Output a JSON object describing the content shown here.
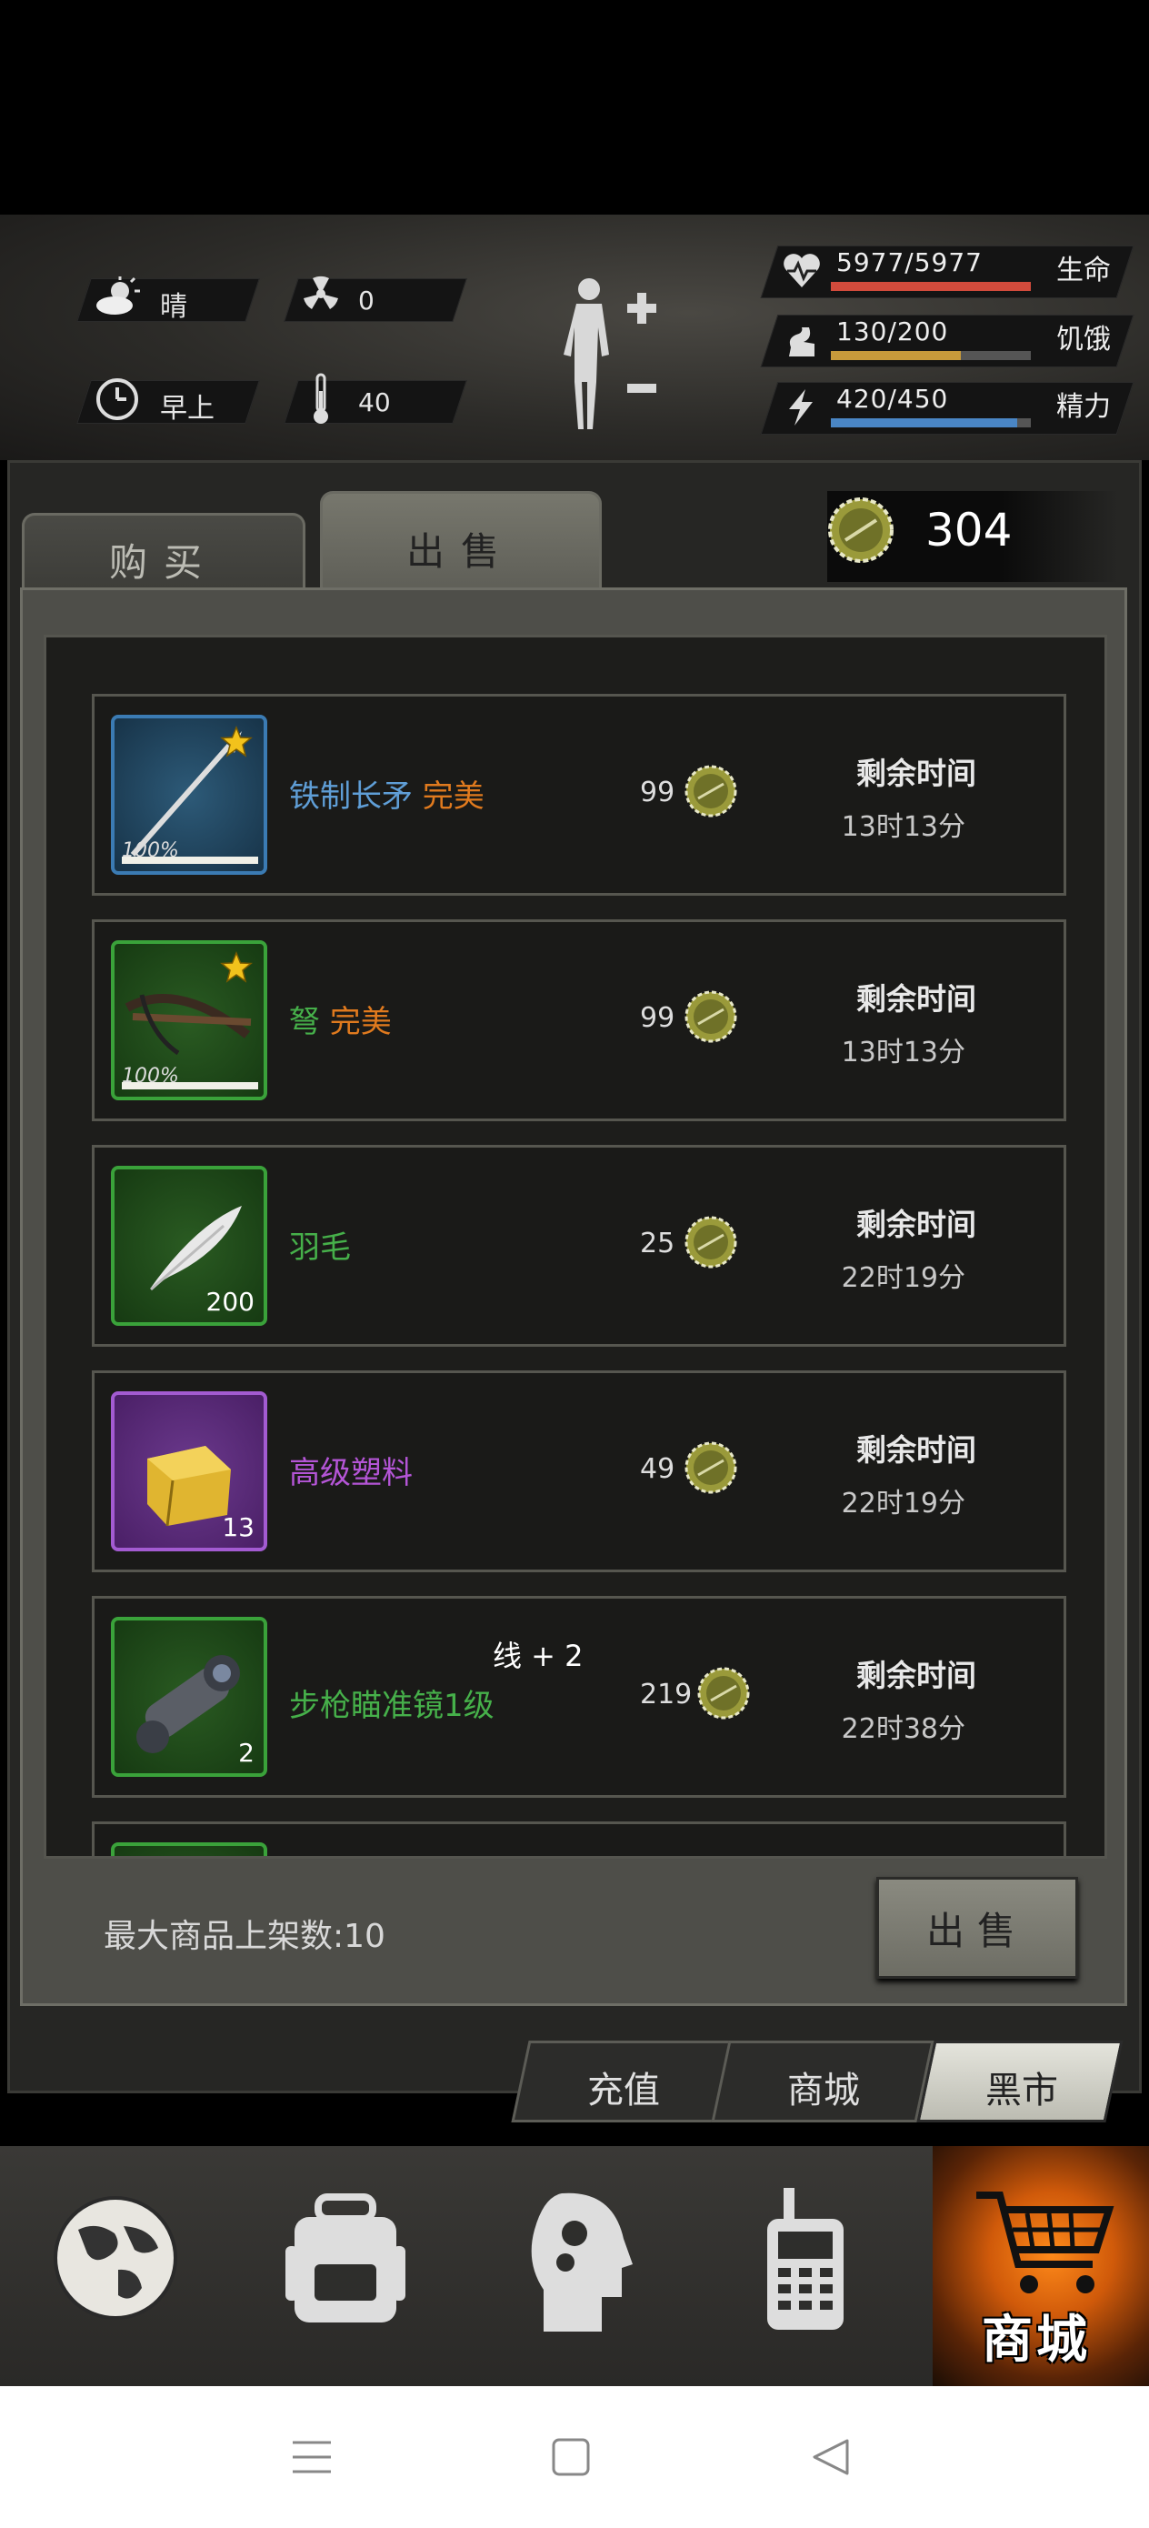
{
  "status": {
    "weather": {
      "icon": "cloud-sun-icon",
      "label": "晴"
    },
    "radiation": {
      "icon": "radiation-icon",
      "value": "0"
    },
    "time_of_day": {
      "icon": "clock-icon",
      "label": "早上"
    },
    "temperature": {
      "icon": "thermometer-icon",
      "value": "40"
    },
    "stats": [
      {
        "name": "生命",
        "value": "5977/5977",
        "fraction": 1.0,
        "color": "#d24b3c",
        "icon": "heart-pulse-icon"
      },
      {
        "name": "饥饿",
        "value": "130/200",
        "fraction": 0.65,
        "color": "#c79a3b",
        "icon": "hunger-icon"
      },
      {
        "name": "精力",
        "value": "420/450",
        "fraction": 0.933,
        "color": "#4a86c5",
        "icon": "energy-icon"
      }
    ]
  },
  "tabs": {
    "buy": "购买",
    "sell": "出售"
  },
  "coins": "304",
  "listings": [
    {
      "name": "铁制长矛",
      "quality": "完美",
      "name_color": "#5f9ed6",
      "price": "99",
      "time_label": "剩余时间",
      "time": "13时13分",
      "slot": "blue",
      "icon": "spear-icon",
      "durability": "100%",
      "star": true
    },
    {
      "name": "弩",
      "quality": "完美",
      "name_color": "#46b04a",
      "price": "99",
      "time_label": "剩余时间",
      "time": "13时13分",
      "slot": "green",
      "icon": "crossbow-icon",
      "durability": "100%",
      "star": true
    },
    {
      "name": "羽毛",
      "quality": "",
      "name_color": "#46b04a",
      "price": "25",
      "time_label": "剩余时间",
      "time": "22时19分",
      "slot": "green",
      "icon": "feather-icon",
      "quantity": "200"
    },
    {
      "name": "高级塑料",
      "quality": "",
      "name_color": "#b455d6",
      "price": "49",
      "time_label": "剩余时间",
      "time": "22时19分",
      "slot": "purple",
      "icon": "plastic-icon",
      "quantity": "13"
    },
    {
      "name": "步枪瞄准镜1级",
      "subtitle": "线 + 2",
      "quality": "",
      "name_color": "#46b04a",
      "price": "219",
      "time_label": "剩余时间",
      "time": "22时38分",
      "slot": "green",
      "icon": "scope-icon",
      "quantity": "2"
    }
  ],
  "max_listings_label": "最大商品上架数:10",
  "sell_button": "出售",
  "shop_tabs": [
    "充值",
    "商城",
    "黑市"
  ],
  "nav": {
    "items": [
      "globe-icon",
      "backpack-icon",
      "brain-icon",
      "radio-icon"
    ],
    "shop_label": "商城"
  },
  "system_nav": [
    "menu-icon",
    "home-icon",
    "back-icon"
  ]
}
